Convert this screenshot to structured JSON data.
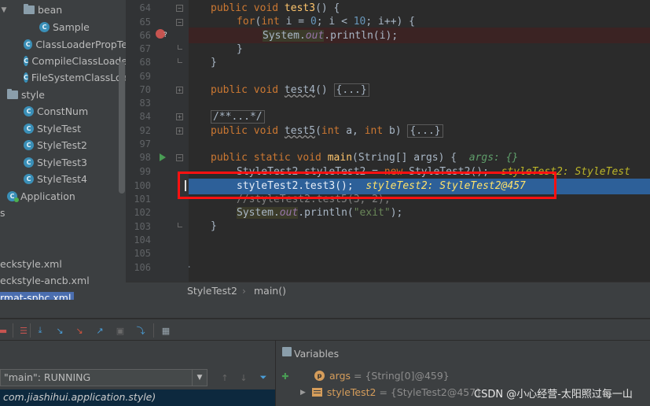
{
  "project_tree": {
    "items": [
      {
        "label": "bean",
        "kind": "folder"
      },
      {
        "label": "Sample",
        "kind": "class"
      },
      {
        "label": "ClassLoaderPropTe",
        "kind": "class"
      },
      {
        "label": "CompileClassLoade",
        "kind": "class"
      },
      {
        "label": "FileSystemClassLoa",
        "kind": "class"
      },
      {
        "label": "style",
        "kind": "folder"
      },
      {
        "label": "ConstNum",
        "kind": "class"
      },
      {
        "label": "StyleTest",
        "kind": "class"
      },
      {
        "label": "StyleTest2",
        "kind": "class"
      },
      {
        "label": "StyleTest3",
        "kind": "class"
      },
      {
        "label": "StyleTest4",
        "kind": "class"
      },
      {
        "label": "Application",
        "kind": "class"
      },
      {
        "label": "s",
        "kind": "text"
      }
    ],
    "files": [
      "eckstyle.xml",
      "eckstyle-ancb.xml",
      "rmat-sphc.xml"
    ]
  },
  "editor": {
    "lines": [
      {
        "num": "64"
      },
      {
        "num": "65"
      },
      {
        "num": "66"
      },
      {
        "num": "67"
      },
      {
        "num": "68"
      },
      {
        "num": "69"
      },
      {
        "num": "70"
      },
      {
        "num": "83"
      },
      {
        "num": "84"
      },
      {
        "num": "92"
      },
      {
        "num": "97"
      },
      {
        "num": "98"
      },
      {
        "num": "99"
      },
      {
        "num": "100"
      },
      {
        "num": "101"
      },
      {
        "num": "102"
      },
      {
        "num": "103"
      },
      {
        "num": "104"
      },
      {
        "num": "105"
      },
      {
        "num": "106"
      }
    ],
    "code": {
      "l64_kw": "public void ",
      "l64_fn": "test3",
      "l64_rest": "() {",
      "l65_kw1": "for",
      "l65_a": "(",
      "l65_kw2": "int ",
      "l65_b": "i = ",
      "l65_n1": "0",
      "l65_c": "; i < ",
      "l65_n2": "10",
      "l65_d": "; i++) {",
      "l66_a": "System.",
      "l66_fld": "out",
      "l66_b": ".println(i);",
      "l67": "}",
      "l68": "}",
      "l70_kw": "public void ",
      "l70_fn": "test4",
      "l70_a": "() ",
      "l70_fold": "{...}",
      "l83": "/**...*/",
      "l84_kw": "public void ",
      "l84_fn": "test5",
      "l84_a": "(",
      "l84_kw2": "int ",
      "l84_b": "a, ",
      "l84_kw3": "int ",
      "l84_c": "b) ",
      "l84_fold": "{...}",
      "l98_kw": "public static void ",
      "l98_fn": "main",
      "l98_a": "(String[] args) {  ",
      "l98_hint": "args: {}",
      "l99_a": "StyleTest2 styleTest2 = ",
      "l99_kw": "new ",
      "l99_b": "StyleTest2();  ",
      "l99_hint": "styleTest2: StyleTest",
      "l100_a": "styleTest2.test3();  ",
      "l100_hint": "styleTest2: StyleTest2@457",
      "l101": "//styleTest2.test5(3, 2);",
      "l102_a": "System.",
      "l102_fld": "out",
      "l102_b": ".println(",
      "l102_str": "\"exit\"",
      "l102_c": ");",
      "l103": "}",
      "l106": "}"
    }
  },
  "breadcrumb": {
    "items": [
      "StyleTest2",
      "main()"
    ],
    "separator": "›"
  },
  "debug": {
    "variables_title": "Variables",
    "thread": "\"main\": RUNNING",
    "frame": "com.jiashihui.application.style)",
    "variables": [
      {
        "name": "args",
        "value": "= {String[0]@459}"
      },
      {
        "name": "styleTest2",
        "value": "= {StyleTest2@457}"
      }
    ]
  },
  "watermark": "CSDN @小心经营-太阳照过每一山",
  "colors": {
    "background": "#2b2b2b",
    "current_line": "#2d6099",
    "breakpoint_line": "#3b2323",
    "highlight_box": "#ff1111",
    "keyword": "#cc7832",
    "method": "#ffc66d",
    "string": "#6a8759",
    "number": "#6897bb"
  }
}
